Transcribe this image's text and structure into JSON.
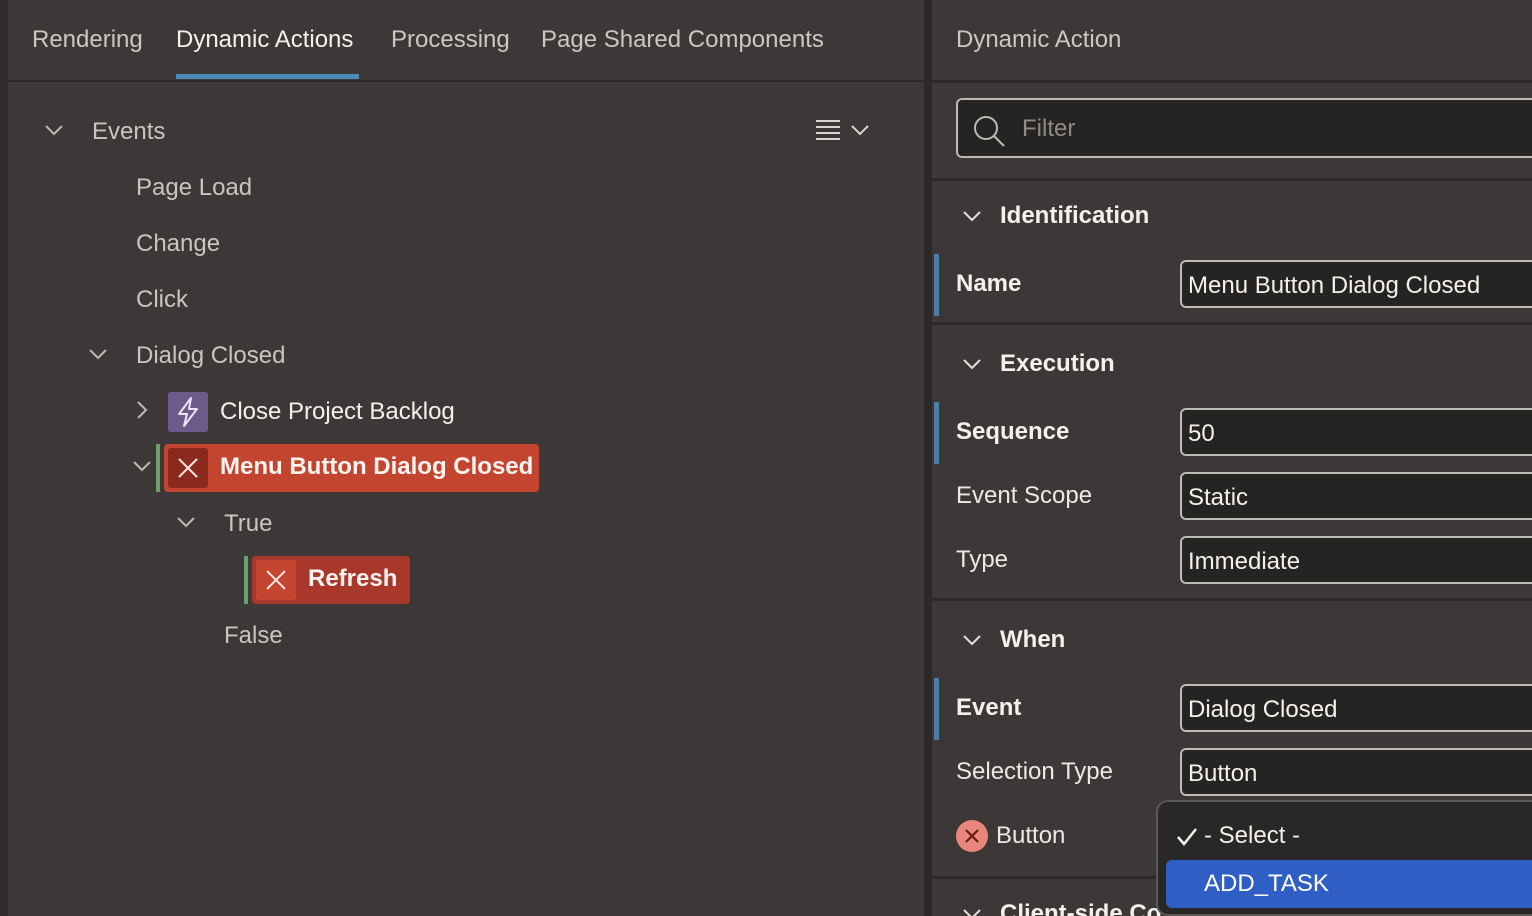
{
  "tabs": [
    "Rendering",
    "Dynamic Actions",
    "Processing",
    "Page Shared Components"
  ],
  "active_tab": "Dynamic Actions",
  "tree": {
    "root": "Events",
    "events": [
      "Page Load",
      "Change",
      "Click",
      "Dialog Closed"
    ],
    "dialog_closed_children": [
      "Close Project Backlog",
      "Menu Button Dialog Closed"
    ],
    "branches": [
      "True",
      "False"
    ],
    "true_action": "Refresh",
    "menu_icon": "hamburger-menu-icon"
  },
  "panel": {
    "title": "Dynamic Action",
    "filter_placeholder": "Filter",
    "identification": {
      "heading": "Identification",
      "name_label": "Name",
      "name_value": "Menu Button Dialog Closed"
    },
    "execution": {
      "heading": "Execution",
      "sequence_label": "Sequence",
      "sequence_value": "50",
      "scope_label": "Event Scope",
      "scope_value": "Static",
      "type_label": "Type",
      "type_value": "Immediate"
    },
    "when": {
      "heading": "When",
      "event_label": "Event",
      "event_value": "Dialog Closed",
      "selection_type_label": "Selection Type",
      "selection_type_value": "Button",
      "button_label": "Button"
    },
    "next_section_partial": "Client-side Co"
  },
  "dropdown": {
    "options": [
      "- Select -",
      "ADD_TASK"
    ],
    "checked": "- Select -",
    "highlighted": "ADD_TASK"
  },
  "colors": {
    "accent": "#4a8ab7",
    "error": "#c4452f",
    "highlight": "#2f5fc4",
    "dynamic_action_icon": "#6b5a8a"
  }
}
